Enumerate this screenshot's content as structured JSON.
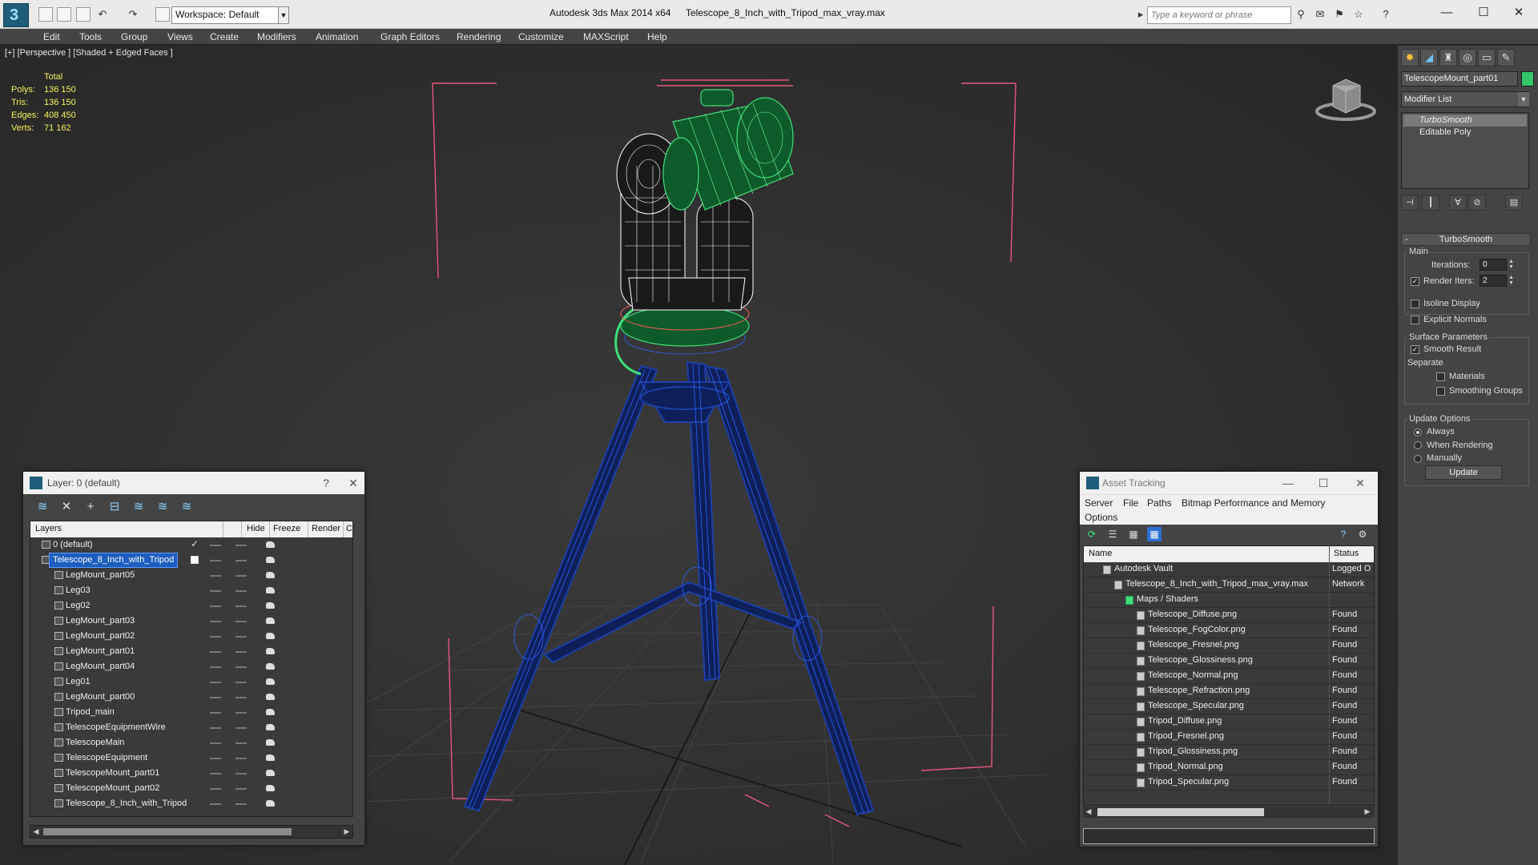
{
  "titlebar": {
    "workspace": "Workspace: Default",
    "app_title": "Autodesk 3ds Max  2014 x64",
    "file_title": "Telescope_8_Inch_with_Tripod_max_vray.max",
    "search_placeholder": "Type a keyword or phrase"
  },
  "menu": [
    "Edit",
    "Tools",
    "Group",
    "Views",
    "Create",
    "Modifiers",
    "Animation",
    "Graph Editors",
    "Rendering",
    "Customize",
    "MAXScript",
    "Help"
  ],
  "viewport": {
    "label": "[+] [Perspective ] [Shaded + Edged Faces ]",
    "stats": {
      "header": "Total",
      "rows": [
        {
          "label": "Polys:",
          "value": "136 150"
        },
        {
          "label": "Tris:",
          "value": "136 150"
        },
        {
          "label": "Edges:",
          "value": "408 450"
        },
        {
          "label": "Verts:",
          "value": "71 162"
        }
      ]
    }
  },
  "command_panel": {
    "object_name": "TelescopeMount_part01",
    "object_color": "#35c76a",
    "modifier_list": "Modifier List",
    "stack": [
      "TurboSmooth",
      "Editable Poly"
    ],
    "rollout": "TurboSmooth",
    "main_group": "Main",
    "iterations_label": "Iterations:",
    "iterations_value": "0",
    "render_iters_label": "Render Iters:",
    "render_iters_value": "2",
    "isoline": "Isoline Display",
    "explicit_normals": "Explicit Normals",
    "surface_group": "Surface Parameters",
    "smooth_result": "Smooth Result",
    "separate": "Separate",
    "materials": "Materials",
    "smoothing_groups": "Smoothing Groups",
    "update_group": "Update Options",
    "always": "Always",
    "when_rendering": "When Rendering",
    "manually": "Manually",
    "update_btn": "Update"
  },
  "layer_dialog": {
    "title": "Layer: 0 (default)",
    "help": "?",
    "close": "✕",
    "columns": {
      "layers": "Layers",
      "hide": "Hide",
      "freeze": "Freeze",
      "render": "Render",
      "c": "C"
    },
    "rows": [
      {
        "name": "0 (default)",
        "level": 0,
        "current": true
      },
      {
        "name": "Telescope_8_Inch_with_Tripod",
        "level": 0,
        "selected": true
      },
      {
        "name": "LegMount_part05",
        "level": 1
      },
      {
        "name": "Leg03",
        "level": 1
      },
      {
        "name": "Leg02",
        "level": 1
      },
      {
        "name": "LegMount_part03",
        "level": 1
      },
      {
        "name": "LegMount_part02",
        "level": 1
      },
      {
        "name": "LegMount_part01",
        "level": 1
      },
      {
        "name": "LegMount_part04",
        "level": 1
      },
      {
        "name": "Leg01",
        "level": 1
      },
      {
        "name": "LegMount_part00",
        "level": 1
      },
      {
        "name": "Tripod_main",
        "level": 1
      },
      {
        "name": "TelescopeEquipmentWire",
        "level": 1
      },
      {
        "name": "TelescopeMain",
        "level": 1
      },
      {
        "name": "TelescopeEquipment",
        "level": 1
      },
      {
        "name": "TelescopeMount_part01",
        "level": 1
      },
      {
        "name": "TelescopeMount_part02",
        "level": 1
      },
      {
        "name": "Telescope_8_Inch_with_Tripod",
        "level": 1
      }
    ]
  },
  "asset_dialog": {
    "title": "Asset Tracking",
    "menu": [
      "Server",
      "File",
      "Paths",
      "Bitmap Performance and Memory",
      "Options"
    ],
    "columns": {
      "name": "Name",
      "status": "Status"
    },
    "rows": [
      {
        "name": "Autodesk Vault",
        "status": "Logged O",
        "level": 1
      },
      {
        "name": "Telescope_8_Inch_with_Tripod_max_vray.max",
        "status": "Network",
        "level": 2
      },
      {
        "name": "Maps / Shaders",
        "status": "",
        "level": 3
      },
      {
        "name": "Telescope_Diffuse.png",
        "status": "Found",
        "level": 4
      },
      {
        "name": "Telescope_FogColor.png",
        "status": "Found",
        "level": 4
      },
      {
        "name": "Telescope_Fresnel.png",
        "status": "Found",
        "level": 4
      },
      {
        "name": "Telescope_Glossiness.png",
        "status": "Found",
        "level": 4
      },
      {
        "name": "Telescope_Normal.png",
        "status": "Found",
        "level": 4
      },
      {
        "name": "Telescope_Refraction.png",
        "status": "Found",
        "level": 4
      },
      {
        "name": "Telescope_Specular.png",
        "status": "Found",
        "level": 4
      },
      {
        "name": "Tripod_Diffuse.png",
        "status": "Found",
        "level": 4
      },
      {
        "name": "Tripod_Fresnel.png",
        "status": "Found",
        "level": 4
      },
      {
        "name": "Tripod_Glossiness.png",
        "status": "Found",
        "level": 4
      },
      {
        "name": "Tripod_Normal.png",
        "status": "Found",
        "level": 4
      },
      {
        "name": "Tripod_Specular.png",
        "status": "Found",
        "level": 4
      }
    ]
  }
}
